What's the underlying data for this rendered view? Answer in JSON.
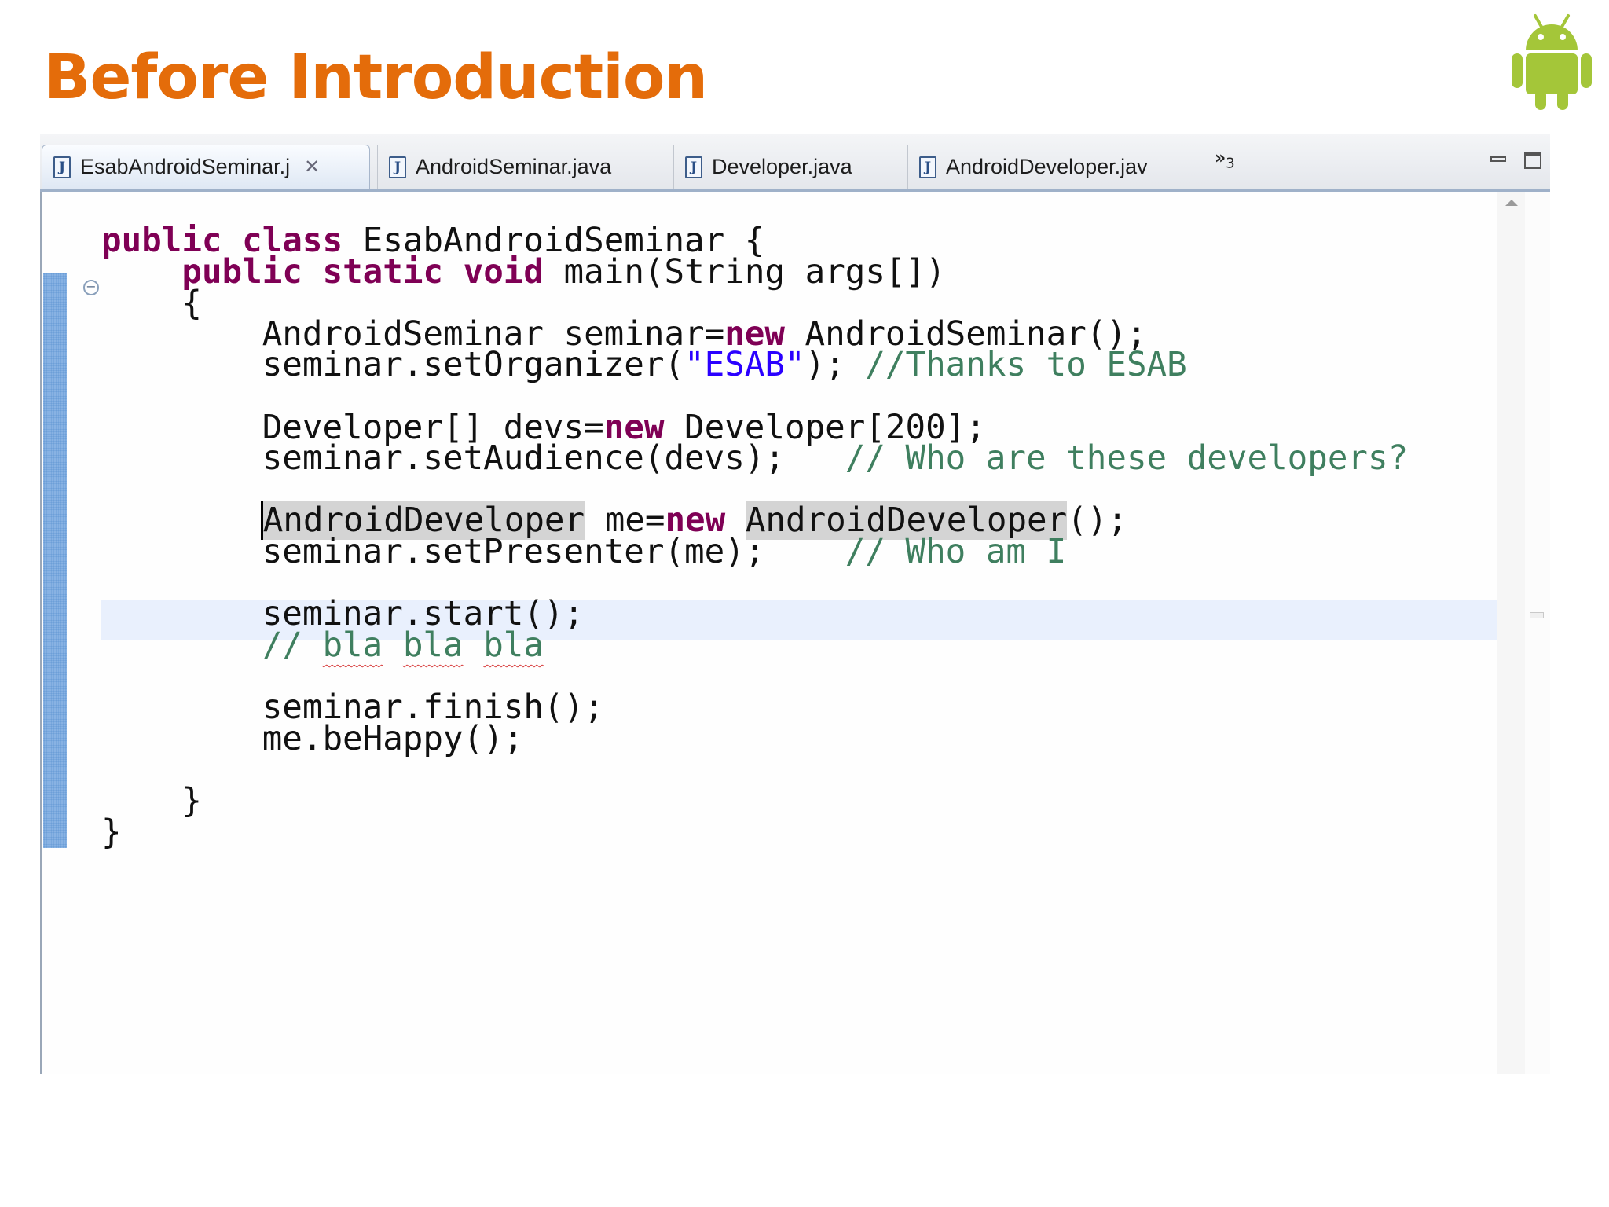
{
  "slide": {
    "title": "Before Introduction",
    "logo_icon": "android-robot-icon",
    "logo_color": "#A4C639",
    "title_color": "#E46C0A"
  },
  "editor_tabs": [
    {
      "label": "EsabAndroidSeminar.j",
      "active": true,
      "closable": true,
      "icon": "java-file-icon"
    },
    {
      "label": "AndroidSeminar.java",
      "active": false,
      "icon": "java-file-icon"
    },
    {
      "label": "Developer.java",
      "active": false,
      "icon": "java-file-icon"
    },
    {
      "label": "AndroidDeveloper.jav",
      "active": false,
      "icon": "java-file-icon"
    }
  ],
  "tab_overflow": {
    "chevrons": "»",
    "count": "3"
  },
  "window_controls": [
    "minimize-icon",
    "maximize-icon"
  ],
  "code": {
    "l1": {
      "kw1": "public",
      "kw2": "class",
      "rest": " EsabAndroidSeminar {"
    },
    "l2": {
      "indent": "    ",
      "kw1": "public",
      "kw2": "static",
      "kw3": "void",
      "rest": " main(String args[])"
    },
    "l3": {
      "text": "    {"
    },
    "l4": {
      "pre": "        AndroidSeminar seminar=",
      "kw": "new",
      "post": " AndroidSeminar();"
    },
    "l5": {
      "pre": "        seminar.setOrganizer(",
      "str": "\"ESAB\"",
      "post": "); ",
      "comment": "//Thanks to ESAB"
    },
    "l6": {
      "pre": "        Developer[] devs=",
      "kw": "new",
      "post": " Developer[200];"
    },
    "l7": {
      "pre": "        seminar.setAudience(devs);   ",
      "comment": "// Who are these developers?"
    },
    "l8": {
      "indent": "        ",
      "occ1": "AndroidDeveloper",
      "mid": " me=",
      "kw": "new",
      "sp": " ",
      "occ2": "AndroidDeveloper",
      "post": "();"
    },
    "l9": {
      "pre": "        seminar.setPresenter(me);    ",
      "comment": "// Who am I"
    },
    "l10": {
      "text": "        seminar.start();"
    },
    "l11": {
      "indent": "        ",
      "comment_prefix": "// ",
      "w1": "bla",
      "w2": "bla",
      "w3": "bla"
    },
    "l12": {
      "text": "        seminar.finish();"
    },
    "l13": {
      "text": "        me.beHappy();"
    },
    "l14": {
      "text": "    }"
    },
    "l15": {
      "text": "}"
    }
  },
  "colors": {
    "keyword": "#7f0055",
    "string": "#2a00ff",
    "comment": "#3f7f5f",
    "current_line": "#e9f0fd",
    "occurrence": "#d4d4d4"
  }
}
